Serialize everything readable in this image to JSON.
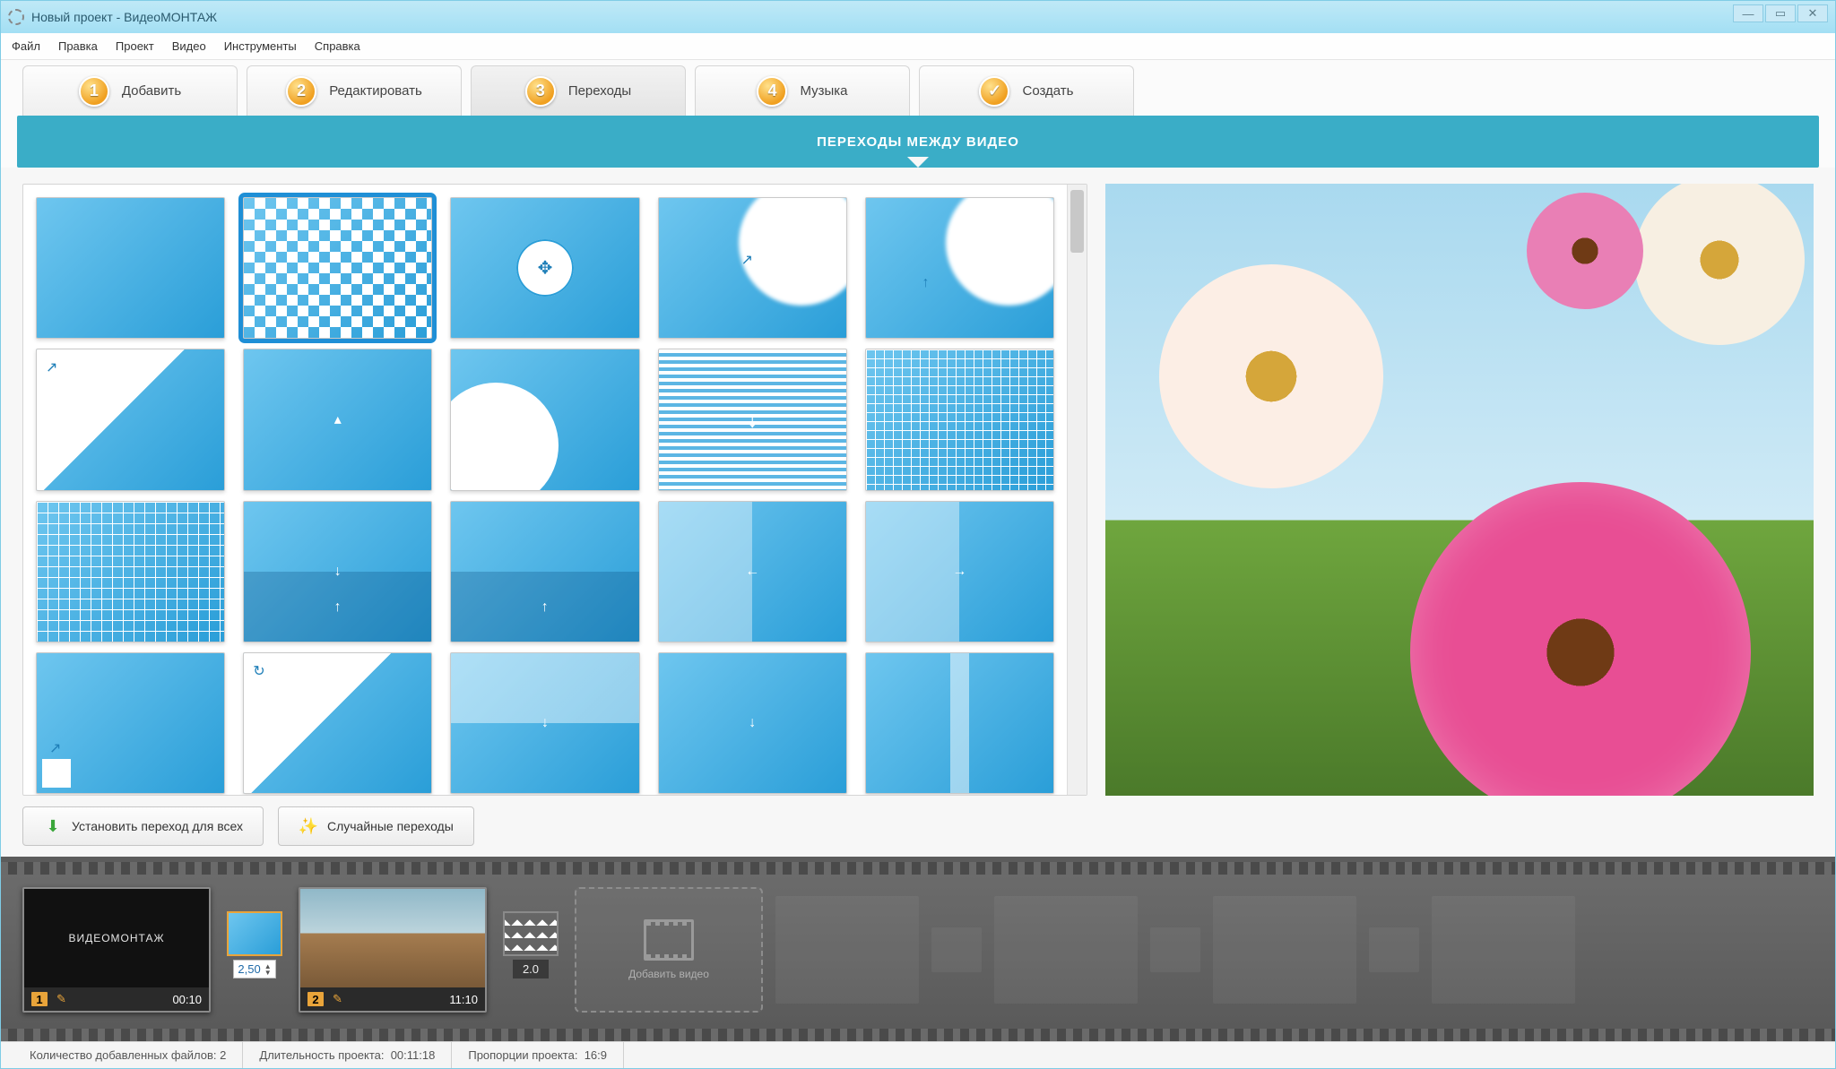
{
  "window": {
    "title": "Новый проект - ВидеоМОНТАЖ"
  },
  "menu": {
    "file": "Файл",
    "edit": "Правка",
    "project": "Проект",
    "video": "Видео",
    "tools": "Инструменты",
    "help": "Справка"
  },
  "steps": {
    "add": {
      "num": "1",
      "label": "Добавить"
    },
    "edit": {
      "num": "2",
      "label": "Редактировать"
    },
    "trans": {
      "num": "3",
      "label": "Переходы"
    },
    "music": {
      "num": "4",
      "label": "Музыка"
    },
    "create": {
      "num": "✓",
      "label": "Создать"
    }
  },
  "banner": {
    "title": "ПЕРЕХОДЫ МЕЖДУ ВИДЕО"
  },
  "actions": {
    "apply_all": "Установить переход для всех",
    "random": "Случайные переходы"
  },
  "timeline": {
    "clip1": {
      "index": "1",
      "duration": "00:10",
      "intro_text": "ВИДЕОМОНТАЖ"
    },
    "trans1": {
      "value": "2,50"
    },
    "clip2": {
      "index": "2",
      "duration": "11:10"
    },
    "trans2": {
      "value": "2.0"
    },
    "add_label": "Добавить видео"
  },
  "status": {
    "files_label": "Количество добавленных файлов:",
    "files_value": "2",
    "duration_label": "Длительность проекта:",
    "duration_value": "00:11:18",
    "aspect_label": "Пропорции проекта:",
    "aspect_value": "16:9"
  }
}
